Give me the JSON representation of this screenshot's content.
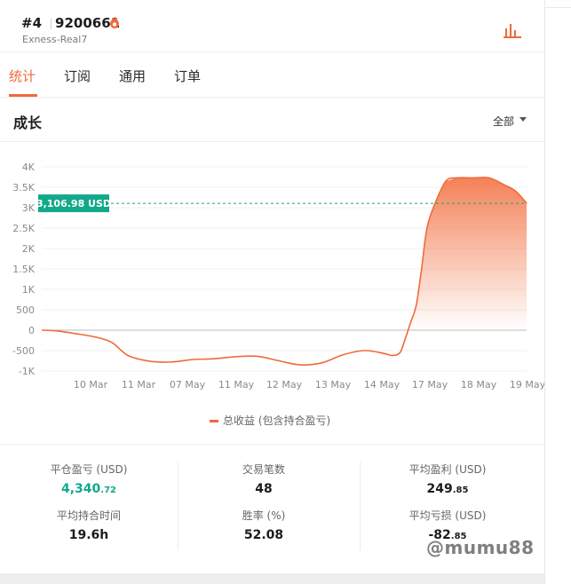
{
  "header": {
    "rank": "#4",
    "account_id": "9200661",
    "server": "Exness-Real7"
  },
  "tabs": [
    {
      "label": "统计",
      "active": true
    },
    {
      "label": "订阅",
      "active": false
    },
    {
      "label": "通用",
      "active": false
    },
    {
      "label": "订单",
      "active": false
    }
  ],
  "section": {
    "title": "成长",
    "filter_label": "全部"
  },
  "chart_data": {
    "type": "area",
    "x_tick_labels": [
      "10 Mar",
      "11 Mar",
      "07 May",
      "11 May",
      "12 May",
      "13 May",
      "14 May",
      "17 May",
      "18 May",
      "19 May"
    ],
    "y_tick_labels": [
      "4K",
      "3.5K",
      "3K",
      "2.5K",
      "2K",
      "1.5K",
      "1K",
      "500",
      "0",
      "-500",
      "-1K"
    ],
    "ylim": [
      -1000,
      4000
    ],
    "series": [
      {
        "name": "总收益 (包含持合盈亏)",
        "x": [
          0,
          0.3,
          0.6,
          1,
          1.3,
          1.6,
          2,
          2.4,
          2.8,
          3.2,
          3.6,
          4,
          4.4,
          4.8,
          5.2,
          5.6,
          6.0,
          6.35,
          6.5,
          6.65,
          6.75,
          6.85,
          6.95,
          7.05,
          7.15,
          7.3,
          7.5,
          7.7,
          8.0,
          8.3,
          8.6,
          8.8,
          9.0
        ],
        "values": [
          0,
          -20,
          -80,
          -170,
          -300,
          -620,
          -760,
          -780,
          -720,
          -700,
          -650,
          -640,
          -750,
          -850,
          -800,
          -600,
          -500,
          -570,
          -620,
          -550,
          -200,
          200,
          600,
          1500,
          2500,
          3100,
          3650,
          3730,
          3730,
          3730,
          3550,
          3400,
          3107
        ]
      }
    ],
    "current_value_label": "3,106.98 USD",
    "current_value": 3106.98,
    "colors": {
      "line": "#ef6a3a",
      "fill_top": "#f47b4f",
      "marker": "#13a88a"
    }
  },
  "stats": [
    {
      "label": "平仓盈亏 (USD)",
      "int": "4,340",
      "dec": ".72",
      "green": true
    },
    {
      "label": "交易笔数",
      "int": "48",
      "dec": "",
      "green": false
    },
    {
      "label": "平均盈利 (USD)",
      "int": "249",
      "dec": ".85",
      "green": false
    },
    {
      "label": "平均持合时间",
      "int": "19.6h",
      "dec": "",
      "green": false
    },
    {
      "label": "胜率 (%)",
      "int": "52.08",
      "dec": "",
      "green": false
    },
    {
      "label": "平均亏损 (USD)",
      "int": "-82",
      "dec": ".85",
      "green": false
    }
  ],
  "watermark": "@mumu88"
}
